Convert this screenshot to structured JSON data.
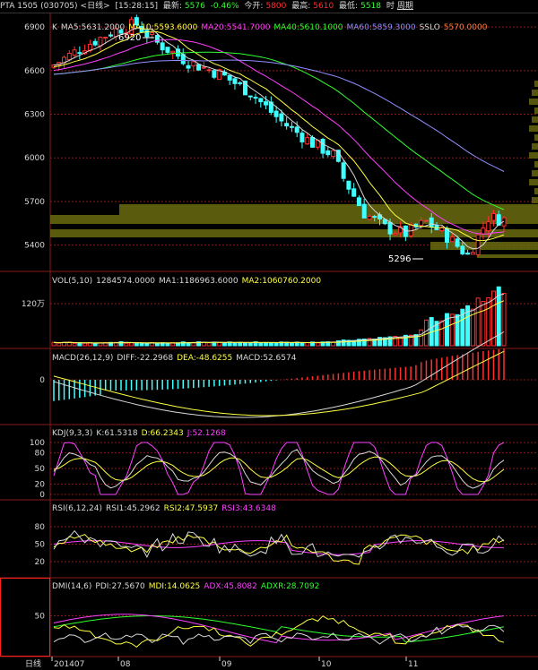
{
  "header": {
    "symbol": "PTA 1505",
    "code": "(030705)",
    "period": "<日线>",
    "time": "[15:28:15]",
    "latest_label": "最新:",
    "latest": "5576",
    "change": "-0.46%",
    "open_label": "今开:",
    "open": "5800",
    "high_label": "最高:",
    "high": "5610",
    "low_label": "最低:",
    "low": "5518",
    "tab1": "时",
    "tab2": "周期"
  },
  "main_panel": {
    "legend": [
      {
        "text": "K",
        "color": "#d8d8d8"
      },
      {
        "text": "MA5:5631.2000",
        "color": "#d8d8d8"
      },
      {
        "text": "MA10:5593.6000",
        "color": "#ffff40"
      },
      {
        "text": "MA20:5541.7000",
        "color": "#ff40ff"
      },
      {
        "text": "MA40:5610.1000",
        "color": "#30ff30"
      },
      {
        "text": "MA60:5859.3000",
        "color": "#9090ff"
      },
      {
        "text": "SSLO",
        "color": "#d8d8d8"
      },
      {
        "text": "5570.0000",
        "color": "#ff8040"
      }
    ],
    "y_ticks": [
      "6900",
      "6600",
      "6300",
      "6000",
      "5700",
      "5400"
    ],
    "high_marker": "6920",
    "low_marker": "5296"
  },
  "vol_panel": {
    "legend": [
      {
        "text": "VOL(5,10)",
        "color": "#d8d8d8"
      },
      {
        "text": "1284574.0000",
        "color": "#d8d8d8"
      },
      {
        "text": "MA1:1186963.6000",
        "color": "#d8d8d8"
      },
      {
        "text": "MA2:1060760.2000",
        "color": "#ffff40"
      }
    ],
    "y_ticks": [
      "120万"
    ]
  },
  "macd_panel": {
    "legend": [
      {
        "text": "MACD(26,12,9)",
        "color": "#d8d8d8"
      },
      {
        "text": "DIFF:-22.2968",
        "color": "#d8d8d8"
      },
      {
        "text": "DEA:-48.6255",
        "color": "#ffff40"
      },
      {
        "text": "MACD:52.6574",
        "color": "#d8d8d8"
      }
    ],
    "y_ticks": [
      "0"
    ]
  },
  "kdj_panel": {
    "legend": [
      {
        "text": "KDJ(9,3,3)",
        "color": "#d8d8d8"
      },
      {
        "text": "K:61.5318",
        "color": "#d8d8d8"
      },
      {
        "text": "D:66.2343",
        "color": "#ffff40"
      },
      {
        "text": "J:52.1268",
        "color": "#ff40ff"
      }
    ],
    "y_ticks": [
      "100",
      "80",
      "50",
      "20",
      "0"
    ]
  },
  "rsi_panel": {
    "legend": [
      {
        "text": "RSI(6,12,24)",
        "color": "#d8d8d8"
      },
      {
        "text": "RSI1:45.2962",
        "color": "#d8d8d8"
      },
      {
        "text": "RSI2:47.5937",
        "color": "#ffff40"
      },
      {
        "text": "RSI3:43.6348",
        "color": "#ff40ff"
      }
    ],
    "y_ticks": [
      "80",
      "50",
      "20"
    ]
  },
  "dmi_panel": {
    "legend": [
      {
        "text": "DMI(14,6)",
        "color": "#d8d8d8"
      },
      {
        "text": "PDI:27.5670",
        "color": "#d8d8d8"
      },
      {
        "text": "MDI:14.0625",
        "color": "#ffff40"
      },
      {
        "text": "ADX:45.8082",
        "color": "#ff40ff"
      },
      {
        "text": "ADXR:28.7092",
        "color": "#30ff30"
      }
    ],
    "y_ticks": [
      "50"
    ]
  },
  "x_axis": {
    "period_label": "日线",
    "labels": [
      "201407",
      "08",
      "09",
      "10",
      "11"
    ]
  },
  "colors": {
    "up": "#ff3030",
    "down": "#40ffff",
    "grid": "#8b1a1a",
    "band": "#6b6b10"
  }
}
